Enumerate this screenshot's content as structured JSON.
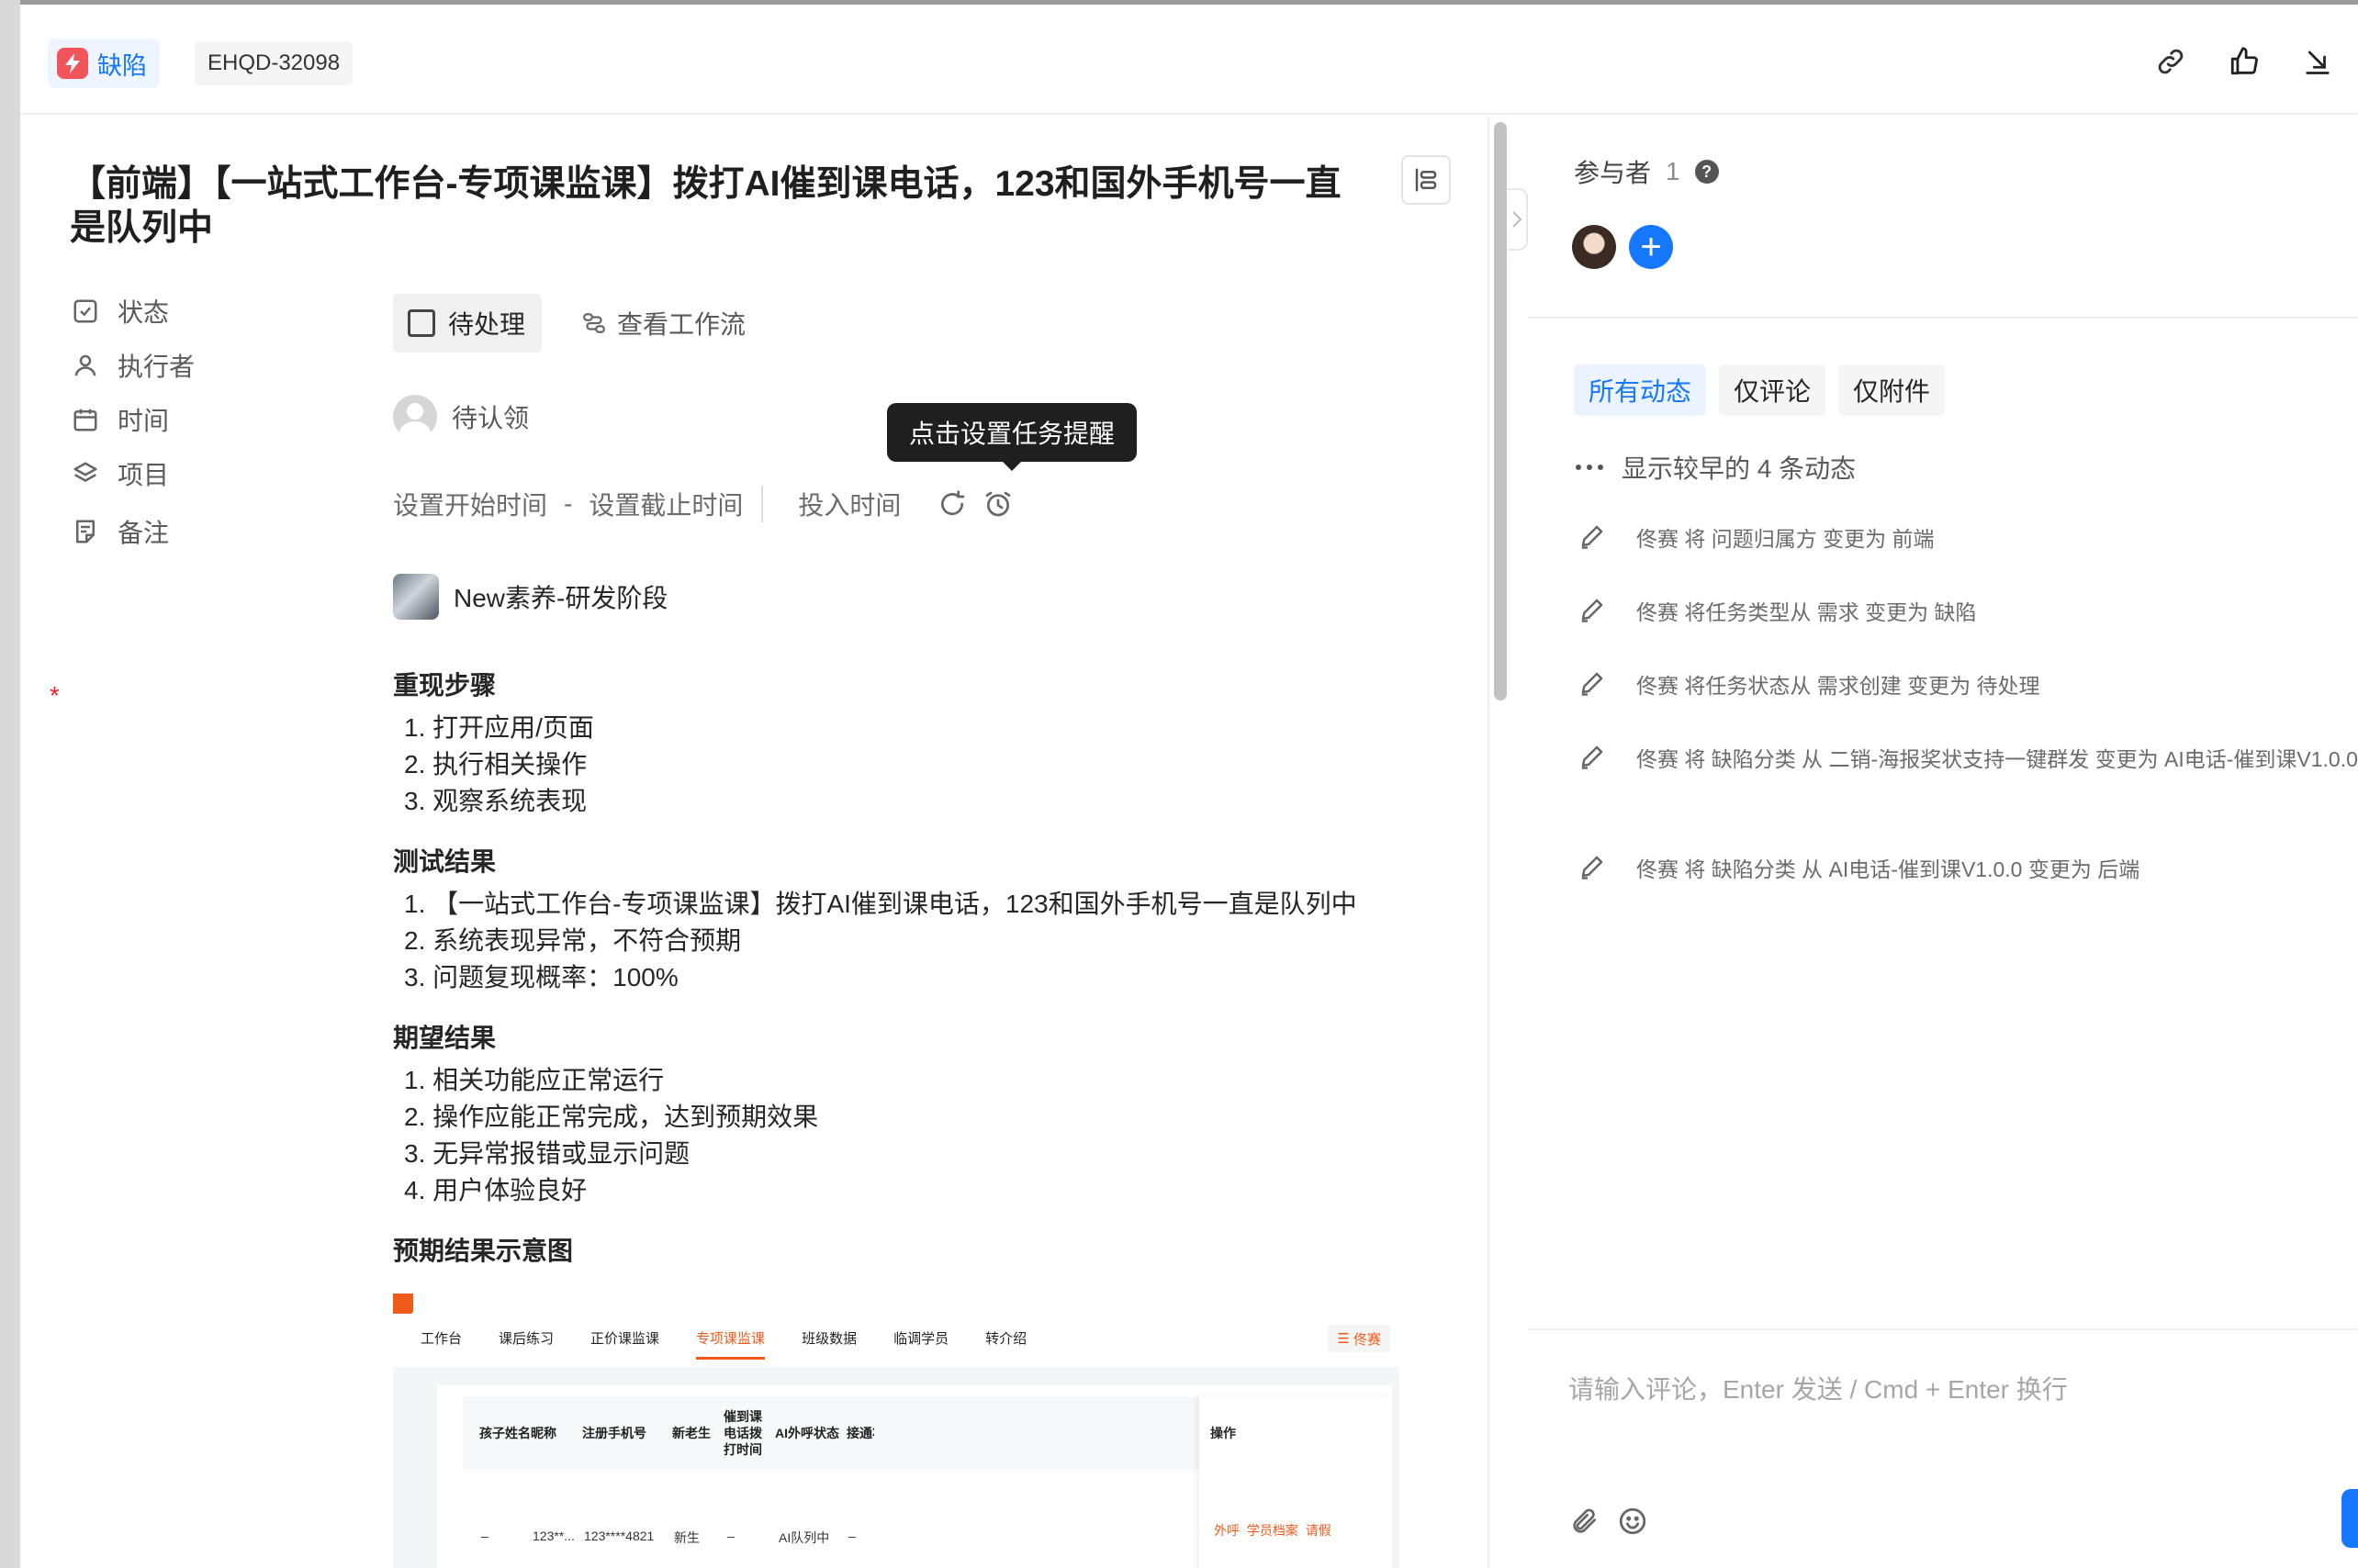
{
  "header": {
    "type_label": "缺陷",
    "id": "EHQD-32098"
  },
  "task": {
    "title": "【前端】【一站式工作台-专项课监课】拨打AI催到课电话，123和国外手机号一直是队列中",
    "fields": {
      "status_label": "状态",
      "assignee_label": "执行者",
      "time_label": "时间",
      "project_label": "项目",
      "notes_label": "备注"
    },
    "status_value": "待处理",
    "workflow_link": "查看工作流",
    "assignee_value": "待认领",
    "time": {
      "start": "设置开始时间",
      "dash": "-",
      "end": "设置截止时间",
      "invest": "投入时间"
    },
    "tooltip": "点击设置任务提醒",
    "project_value": "New素养-研发阶段",
    "notes": {
      "repro_title": "重现步骤",
      "repro_steps": [
        "1. 打开应用/页面",
        "2. 执行相关操作",
        "3. 观察系统表现"
      ],
      "test_title": "测试结果",
      "test_results": [
        "1. 【一站式工作台-专项课监课】拨打AI催到课电话，123和国外手机号一直是队列中",
        "2. 系统表现异常，不符合预期",
        "3. 问题复现概率：100%"
      ],
      "expect_title": "期望结果",
      "expect_results": [
        "1. 相关功能应正常运行",
        "2. 操作应能正常完成，达到预期效果",
        "3. 无异常报错或显示问题",
        "4. 用户体验良好"
      ],
      "image_title": "预期结果示意图"
    }
  },
  "embedded_screenshot": {
    "tabs": [
      "工作台",
      "课后练习",
      "正价课监课",
      "专项课监课",
      "班级数据",
      "临调学员",
      "转介绍"
    ],
    "active_tab": "专项课监课",
    "user": "佟赛",
    "columns": [
      "孩子姓名",
      "昵称",
      "注册手机号",
      "新老生",
      "催到课电话拨打时间",
      "AI外呼状态",
      "接通状"
    ],
    "ops_header": "操作",
    "row": [
      "–",
      "123**...",
      "123****4821",
      "新生",
      "–",
      "AI队列中",
      "–"
    ],
    "ops_links": "外呼 学员档案 请假"
  },
  "sidebar": {
    "participants_label": "参与者",
    "participants_count": "1",
    "help_icon": "?",
    "add_icon": "+",
    "filters": [
      "所有动态",
      "仅评论",
      "仅附件"
    ],
    "earlier": "显示较早的 4 条动态",
    "activities": [
      "佟赛 将 问题归属方 变更为 前端",
      "佟赛 将任务类型从 需求 变更为 缺陷",
      "佟赛 将任务状态从 需求创建 变更为 待处理",
      "佟赛 将 缺陷分类 从 二销-海报奖状支持一键群发 变更为 AI电话-催到课V1.0.0",
      "佟赛 将 缺陷分类 从 AI电话-催到课V1.0.0 变更为 后端"
    ],
    "comment_placeholder": "请输入评论，Enter 发送 / Cmd + Enter 换行"
  },
  "colors": {
    "accent": "#1677ff",
    "bug_red": "#f2545b",
    "embedded_orange": "#f25a1b"
  }
}
